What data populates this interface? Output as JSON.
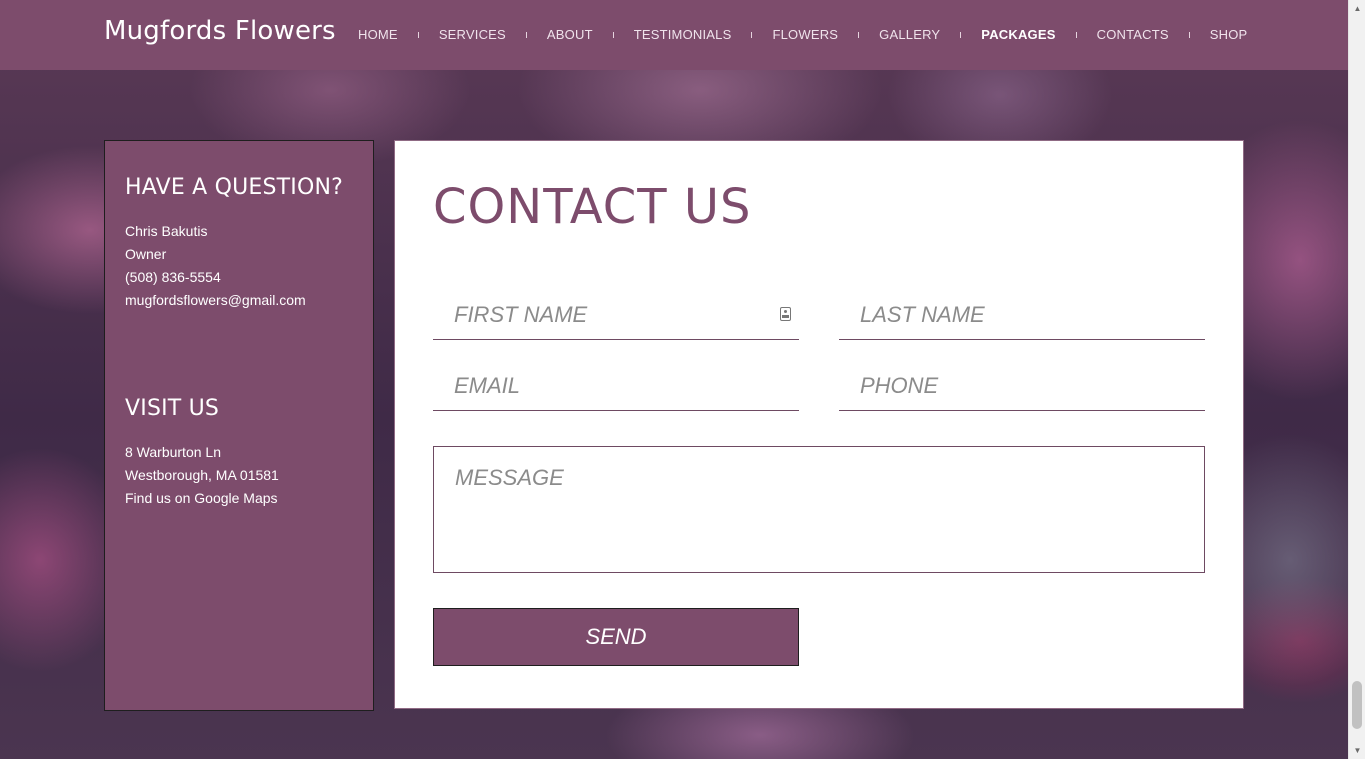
{
  "nav": {
    "brand": "Mugfords Flowers",
    "items": [
      {
        "label": "HOME",
        "active": false
      },
      {
        "label": "SERVICES",
        "active": false
      },
      {
        "label": "ABOUT",
        "active": false
      },
      {
        "label": "TESTIMONIALS",
        "active": false
      },
      {
        "label": "FLOWERS",
        "active": false
      },
      {
        "label": "GALLERY",
        "active": false
      },
      {
        "label": "PACKAGES",
        "active": true
      },
      {
        "label": "CONTACTS",
        "active": false
      },
      {
        "label": "SHOP",
        "active": false
      }
    ]
  },
  "info": {
    "question_heading": "HAVE A QUESTION?",
    "name": "Chris Bakutis",
    "role": "Owner",
    "phone": "(508) 836-5554",
    "email": "mugfordsflowers@gmail.com",
    "visit_heading": "VISIT US",
    "address_line1": "8 Warburton Ln",
    "address_line2": "Westborough, MA 01581",
    "maps_link": "Find us on Google Maps"
  },
  "form": {
    "title": "CONTACT US",
    "first_name_placeholder": "FIRST NAME",
    "last_name_placeholder": "LAST NAME",
    "email_placeholder": "EMAIL",
    "phone_placeholder": "PHONE",
    "message_placeholder": "MESSAGE",
    "send_label": "SEND"
  },
  "colors": {
    "brand_purple": "#7d4c6c",
    "white": "#ffffff"
  },
  "icons": {
    "autofill": "contact-card-icon",
    "scroll_up": "scroll-up-arrow-icon",
    "scroll_down": "scroll-down-arrow-icon"
  }
}
